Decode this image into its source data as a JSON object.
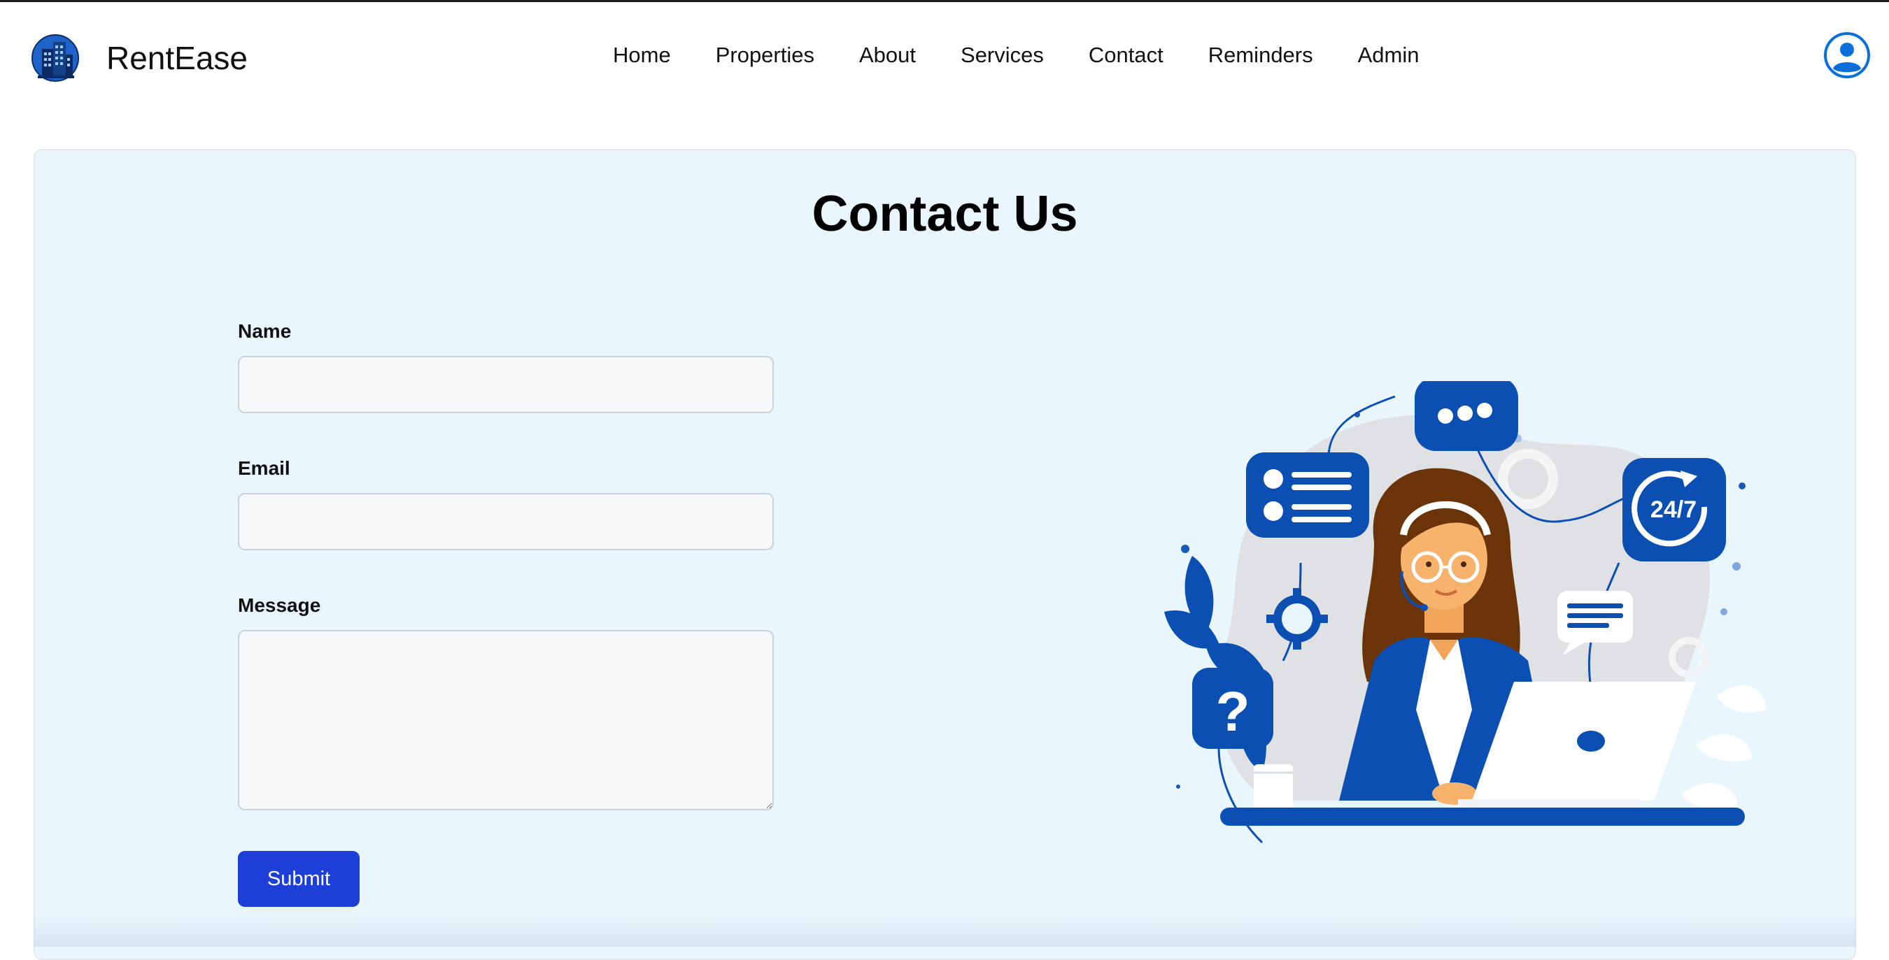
{
  "brand": {
    "name": "RentEase",
    "logo_icon": "building-logo-icon"
  },
  "nav": {
    "items": [
      "Home",
      "Properties",
      "About",
      "Services",
      "Contact",
      "Reminders",
      "Admin"
    ]
  },
  "user": {
    "icon": "user-circle-icon"
  },
  "page": {
    "title": "Contact Us"
  },
  "form": {
    "name_label": "Name",
    "name_value": "",
    "email_label": "Email",
    "email_value": "",
    "message_label": "Message",
    "message_value": "",
    "submit_label": "Submit"
  },
  "illustration": {
    "badge_text": "24/7",
    "question_mark": "?"
  },
  "colors": {
    "accent": "#0a4fb1",
    "submit": "#1d3fd8",
    "panel_bg": "#eaf6fe",
    "input_bg": "#f6f8fa"
  }
}
